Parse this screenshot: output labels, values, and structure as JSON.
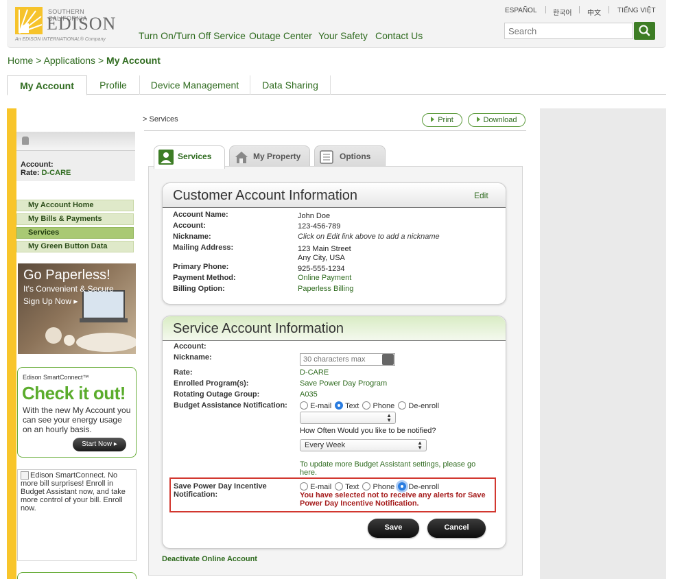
{
  "header": {
    "logo": {
      "top": "SOUTHERN CALIFORNIA",
      "name": "EDISON",
      "tagline": "An EDISON INTERNATIONAL® Company"
    },
    "nav": [
      "Turn On/Turn Off Service",
      "Outage Center",
      "Your Safety",
      "Contact Us"
    ],
    "languages": [
      "ESPAÑOL",
      "한국어",
      "中文",
      "TIẾNG VIỆT"
    ],
    "search_placeholder": "Search",
    "colors": {
      "brand_green": "#2f6b1f",
      "accent_yellow": "#f8c52a",
      "search_button": "#3d7d25"
    }
  },
  "breadcrumb": {
    "home": "Home",
    "sep": ">",
    "applications": "Applications",
    "current": "My Account"
  },
  "main_tabs": [
    "My Account",
    "Profile",
    "Device Management",
    "Data Sharing"
  ],
  "sidebar": {
    "account_label": "Account:",
    "rate_label": "Rate:",
    "rate_value": "D-CARE",
    "items": [
      "My Account Home",
      "My Bills & Payments",
      "Services",
      "My Green Button Data"
    ],
    "paperless": {
      "title": "Go Paperless!",
      "subtitle": "It's Convenient & Secure",
      "cta": "Sign Up Now"
    },
    "smartconnect": {
      "heading": "Edison SmartConnect™",
      "big": "Check it out!",
      "body": "With the new My Account you can see your energy usage on an hourly basis.",
      "button": "Start Now"
    },
    "broken_ad_alt": "Edison SmartConnect. No more bill surprises! Enroll in Budget Assistant now, and take more control of your bill. Enroll now."
  },
  "content": {
    "crumb": "> Services",
    "print": "Print",
    "download": "Download",
    "sub_tabs": [
      "Services",
      "My Property",
      "Options"
    ],
    "customer_card": {
      "title": "Customer Account Information",
      "edit": "Edit",
      "rows": [
        {
          "label": "Account Name:",
          "value": "John Doe"
        },
        {
          "label": "Account:",
          "value": "123-456-789"
        },
        {
          "label": "Nickname:",
          "value": "Click on Edit link above to add a nickname"
        },
        {
          "label": "Mailing Address:",
          "value": "123 Main Street",
          "value2": "Any City, USA"
        },
        {
          "label": "Primary Phone:",
          "value": "925-555-1234"
        },
        {
          "label": "Payment Method:",
          "value": "Online Payment"
        },
        {
          "label": "Billing Option:",
          "value": "Paperless Billing"
        }
      ]
    },
    "service_card": {
      "title": "Service Account Information",
      "account_label": "Account:",
      "nickname_label": "Nickname:",
      "nickname_placeholder": "30 characters max",
      "rate_label": "Rate:",
      "rate_value": "D-CARE",
      "programs_label": "Enrolled Program(s):",
      "programs_value": "Save Power Day Program",
      "outage_label": "Rotating Outage Group:",
      "outage_value": "A035",
      "budget_label": "Budget Assistance Notification:",
      "radio_options": [
        "E-mail",
        "Text",
        "Phone",
        "De-enroll"
      ],
      "budget_selected": "Text",
      "budget_dropdown_value": "",
      "how_often_label": "How Often Would you like to be notified?",
      "frequency_value": "Every Week",
      "update_text": "To update more Budget Assistant settings, please go here.",
      "spd_label": "Save Power Day Incentive Notification:",
      "spd_selected": "De-enroll",
      "spd_warning": "You have selected not to receive any alerts for Save Power Day Incentive Notification.",
      "save": "Save",
      "cancel": "Cancel",
      "warning_color": "#a51c1c",
      "highlight_color": "#d2372f"
    },
    "deactivate": "Deactivate Online Account"
  }
}
